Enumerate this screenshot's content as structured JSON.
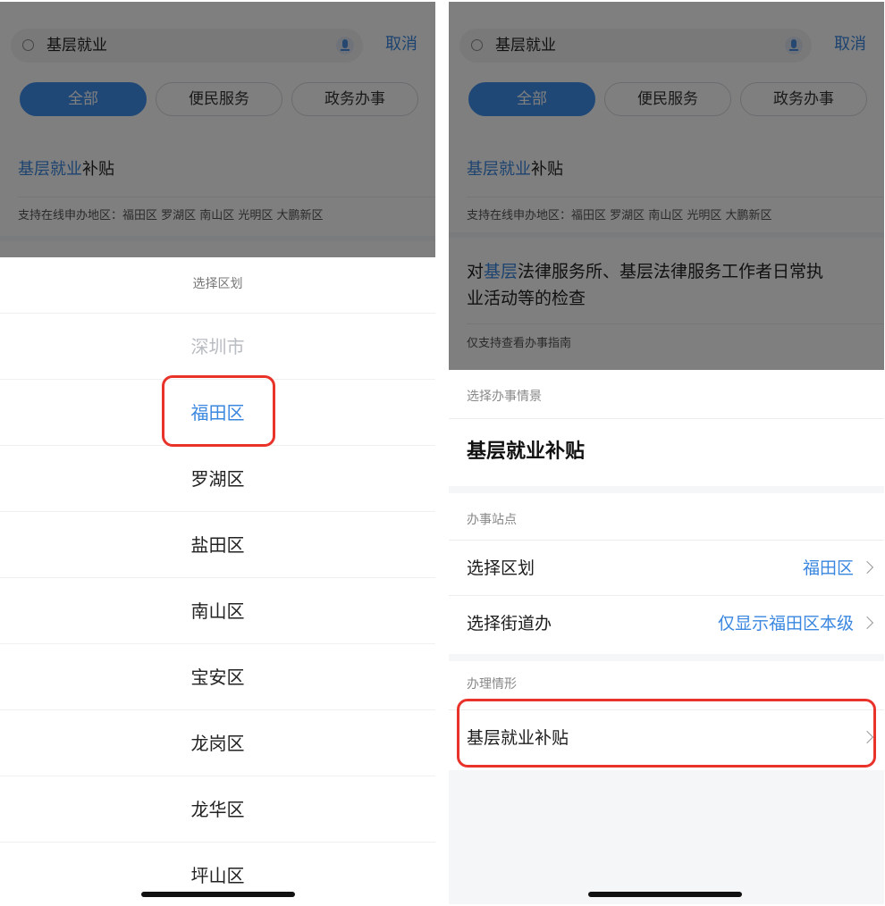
{
  "left": {
    "search": {
      "query": "基层就业",
      "cancel_label": "取消"
    },
    "tabs": [
      {
        "label": "全部"
      },
      {
        "label": "便民服务"
      },
      {
        "label": "政务办事"
      }
    ],
    "result": {
      "title_hl": "基层就业",
      "title_rest": "补贴",
      "sub": "支持在线申办地区：福田区 罗湖区 南山区 光明区 大鹏新区"
    },
    "sheet": {
      "title": "选择区划",
      "items": [
        {
          "label": "深圳市"
        },
        {
          "label": "福田区"
        },
        {
          "label": "罗湖区"
        },
        {
          "label": "盐田区"
        },
        {
          "label": "南山区"
        },
        {
          "label": "宝安区"
        },
        {
          "label": "龙岗区"
        },
        {
          "label": "龙华区"
        },
        {
          "label": "坪山区"
        }
      ]
    }
  },
  "right": {
    "search": {
      "query": "基层就业",
      "cancel_label": "取消"
    },
    "tabs": [
      {
        "label": "全部"
      },
      {
        "label": "便民服务"
      },
      {
        "label": "政务办事"
      }
    ],
    "result1": {
      "title_hl": "基层就业",
      "title_rest": "补贴",
      "sub": "支持在线申办地区：福田区 罗湖区 南山区 光明区 大鹏新区"
    },
    "result2": {
      "line1_pre": "对",
      "line1_hl": "基层",
      "line1_rest": "法律服务所、基层法律服务工作者日常执",
      "line2": "业活动等的检查",
      "sub": "仅支持查看办事指南"
    },
    "scenario": {
      "label": "选择办事情景",
      "title": "基层就业补贴"
    },
    "station": {
      "label": "办事站点",
      "district_label": "选择区划",
      "district_value": "福田区",
      "street_label": "选择街道办",
      "street_value": "仅显示福田区本级"
    },
    "situation": {
      "label": "办理情形",
      "item": "基层就业补贴"
    }
  },
  "colors": {
    "accent": "#3a87e0",
    "tab_active": "#4191ee",
    "highlight_box": "#e8322a"
  }
}
